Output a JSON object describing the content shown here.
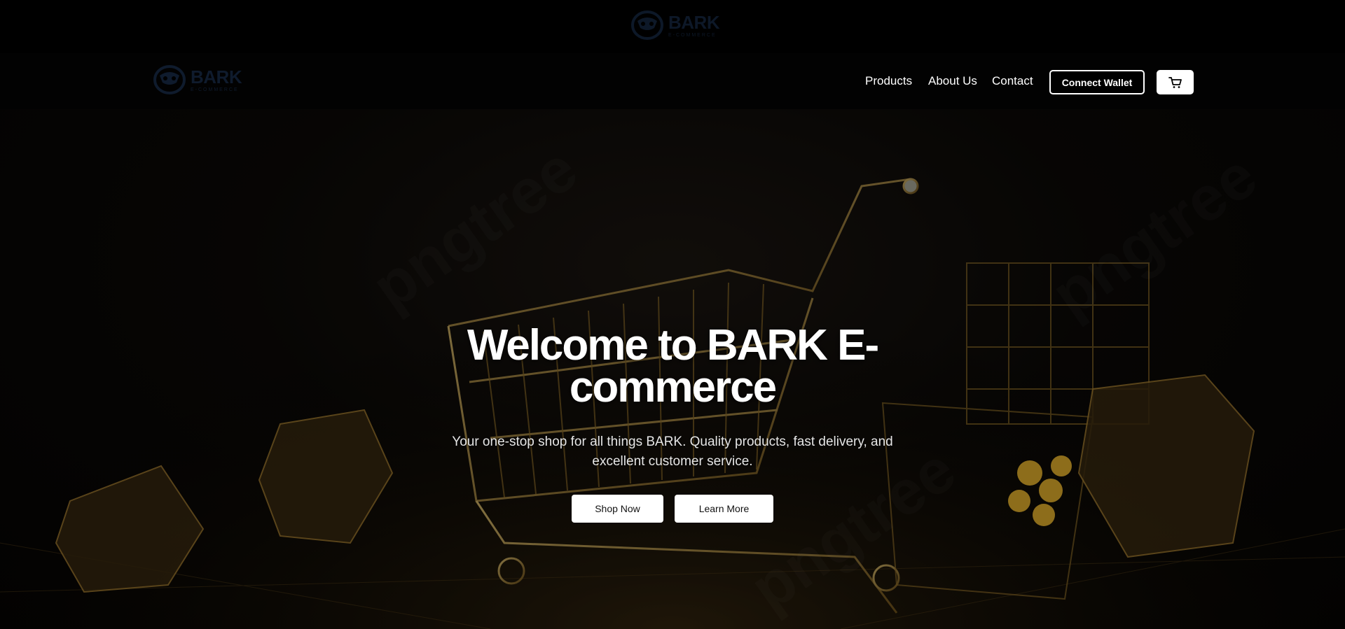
{
  "brand": {
    "name": "BARK",
    "tagline": "E-COMMERCE"
  },
  "nav": {
    "links": [
      "Products",
      "About Us",
      "Contact"
    ],
    "connect_wallet": "Connect Wallet"
  },
  "hero": {
    "title_line1": "Welcome to BARK E-",
    "title_line2": "commerce",
    "subtitle_line1": "Your one-stop shop for all things BARK. Quality products, fast delivery, and",
    "subtitle_line2": "excellent customer service.",
    "shop_now": "Shop Now",
    "learn_more": "Learn More"
  },
  "colors": {
    "background": "#000000",
    "logo": "#0f1b2d",
    "accent_gold": "#c9a34a",
    "button_bg": "#ffffff"
  },
  "icons": {
    "cart": "cart-icon",
    "logo": "bark-logo-icon"
  }
}
